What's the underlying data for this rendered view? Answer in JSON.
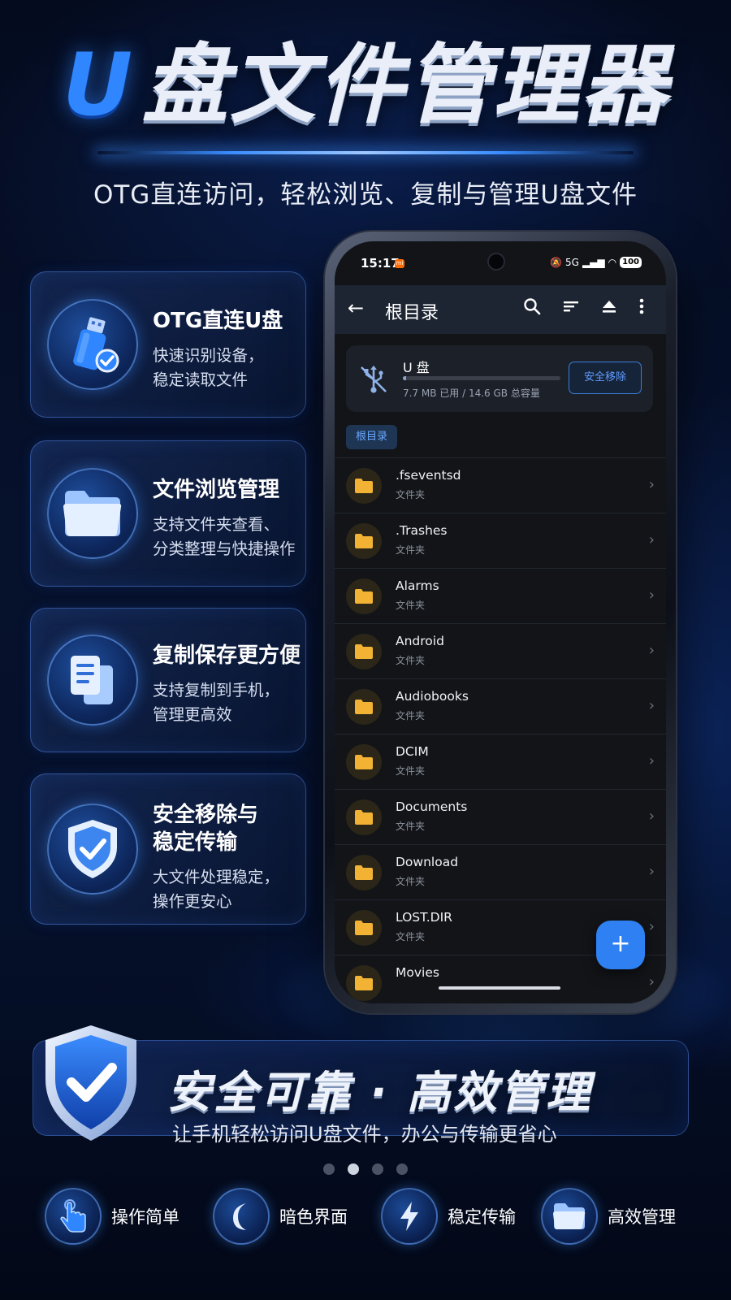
{
  "hero": {
    "title_u": "U",
    "title_rest": "盘文件管理器",
    "subtitle": "OTG直连访问，轻松浏览、复制与管理U盘文件"
  },
  "features": [
    {
      "title": "OTG直连U盘",
      "desc_line1": "快速识别设备，",
      "desc_line2": "稳定读取文件",
      "icon": "usb-drive-icon"
    },
    {
      "title": "文件浏览管理",
      "desc_line1": "支持文件夹查看、",
      "desc_line2": "分类整理与快捷操作",
      "icon": "folder-icon"
    },
    {
      "title": "复制保存更方便",
      "desc_line1": "支持复制到手机，",
      "desc_line2": "管理更高效",
      "icon": "copy-icon"
    },
    {
      "title_line1": "安全移除与",
      "title_line2": "稳定传输",
      "desc_line1": "大文件处理稳定，",
      "desc_line2": "操作更安心",
      "icon": "shield-check-icon"
    }
  ],
  "phone": {
    "status": {
      "time": "15:17",
      "battery": "100",
      "signal": "5G"
    },
    "appbar": {
      "back_icon": "back-arrow-icon",
      "title": "根目录",
      "icons": [
        "search-icon",
        "sort-icon",
        "eject-icon",
        "more-icon"
      ]
    },
    "usb": {
      "name": "U 盘",
      "usage": "7.7 MB 已用 / 14.6 GB 总容量",
      "used_fraction": 0.0005,
      "eject_label": "安全移除"
    },
    "breadcrumb": "根目录",
    "files": [
      {
        "name": ".fseventsd",
        "type": "文件夹"
      },
      {
        "name": ".Trashes",
        "type": "文件夹"
      },
      {
        "name": "Alarms",
        "type": "文件夹"
      },
      {
        "name": "Android",
        "type": "文件夹"
      },
      {
        "name": "Audiobooks",
        "type": "文件夹"
      },
      {
        "name": "DCIM",
        "type": "文件夹"
      },
      {
        "name": "Documents",
        "type": "文件夹"
      },
      {
        "name": "Download",
        "type": "文件夹"
      },
      {
        "name": "LOST.DIR",
        "type": "文件夹"
      },
      {
        "name": "Movies",
        "type": ""
      }
    ],
    "fab_label": "+"
  },
  "banner": {
    "title": "安全可靠 · 高效管理",
    "subtitle": "让手机轻松访问U盘文件，办公与传输更省心"
  },
  "pager": {
    "count": 4,
    "active": 1
  },
  "bottom_features": [
    {
      "label": "操作简单",
      "icon": "tap-hand-icon"
    },
    {
      "label": "暗色界面",
      "icon": "moon-icon"
    },
    {
      "label": "稳定传输",
      "icon": "lightning-icon"
    },
    {
      "label": "高效管理",
      "icon": "folder-icon"
    }
  ],
  "colors": {
    "accent": "#2f86ff",
    "folder": "#f2b233",
    "background": "#050e26"
  }
}
